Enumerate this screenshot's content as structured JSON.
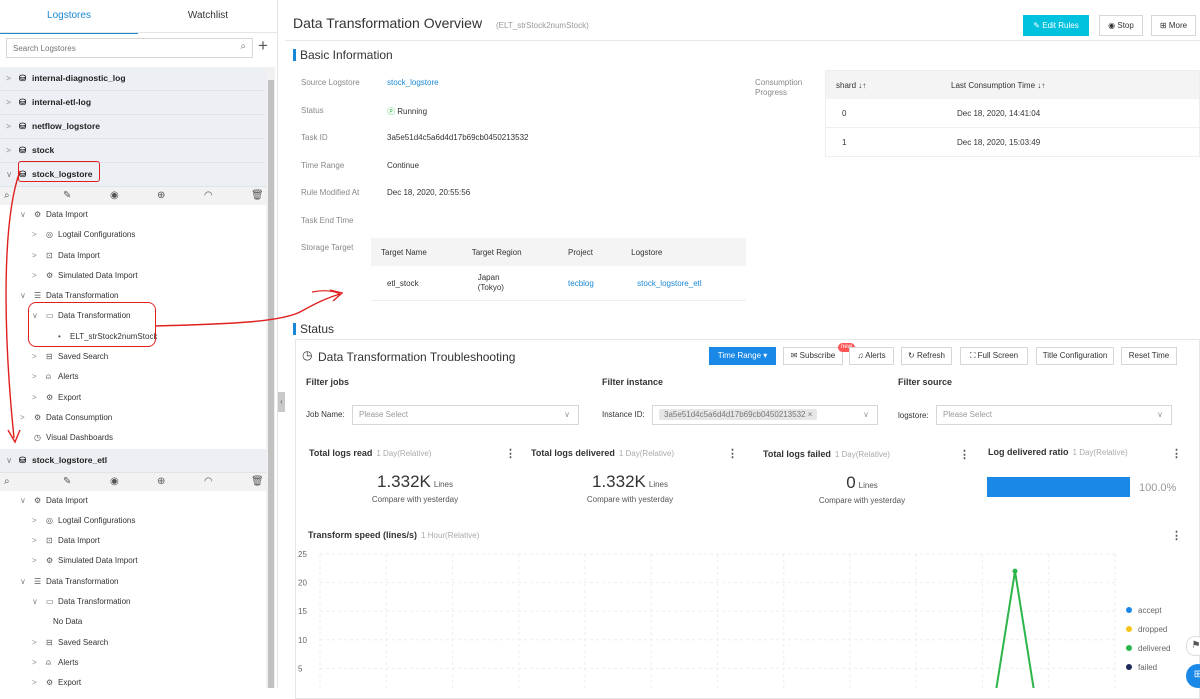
{
  "sidebar": {
    "tabs": [
      "Logstores",
      "Watchlist"
    ],
    "search_placeholder": "Search Logstores",
    "logstores": [
      "internal-diagnostic_log",
      "internal-etl-log",
      "netflow_logstore",
      "stock",
      "stock_logstore"
    ],
    "tree1": [
      {
        "label": "Data Import",
        "chev": "∨",
        "icon": "⚙"
      },
      {
        "label": "Logtail Configurations",
        "chev": ">",
        "icon": "◎"
      },
      {
        "label": "Data Import",
        "chev": ">",
        "icon": "⊡"
      },
      {
        "label": "Simulated Data Import",
        "chev": ">",
        "icon": "⚙"
      },
      {
        "label": "Data Transformation",
        "chev": "∨",
        "icon": "☰"
      },
      {
        "label": "Data Transformation",
        "chev": "∨",
        "icon": "▭"
      },
      {
        "label": "ELT_strStock2numStock",
        "chev": "",
        "icon": "•"
      },
      {
        "label": "Saved Search",
        "chev": ">",
        "icon": "⊟"
      },
      {
        "label": "Alerts",
        "chev": ">",
        "icon": "⍝"
      },
      {
        "label": "Export",
        "chev": ">",
        "icon": "⚙"
      },
      {
        "label": "Data Consumption",
        "chev": ">",
        "icon": "⚙"
      },
      {
        "label": "Visual Dashboards",
        "chev": "",
        "icon": "◷"
      }
    ],
    "logstore_etl": "stock_logstore_etl",
    "tree2": [
      {
        "label": "Data Import",
        "chev": "∨",
        "icon": "⚙"
      },
      {
        "label": "Logtail Configurations",
        "chev": ">",
        "icon": "◎"
      },
      {
        "label": "Data Import",
        "chev": ">",
        "icon": "⊡"
      },
      {
        "label": "Simulated Data Import",
        "chev": ">",
        "icon": "⚙"
      },
      {
        "label": "Data Transformation",
        "chev": "∨",
        "icon": "☰"
      },
      {
        "label": "Data Transformation",
        "chev": "∨",
        "icon": "▭"
      },
      {
        "label": "No Data",
        "chev": "",
        "icon": ""
      },
      {
        "label": "Saved Search",
        "chev": ">",
        "icon": "⊟"
      },
      {
        "label": "Alerts",
        "chev": ">",
        "icon": "⍝"
      },
      {
        "label": "Export",
        "chev": ">",
        "icon": "⚙"
      }
    ]
  },
  "header": {
    "title": "Data Transformation Overview",
    "subtitle": "(ELT_strStock2numStock)",
    "edit_rules": "Edit Rules",
    "stop": "Stop",
    "more": "More"
  },
  "basic": {
    "title": "Basic Information",
    "source_label": "Source Logstore",
    "source_value": "stock_logstore",
    "status_label": "Status",
    "status_value": "Running",
    "task_id_label": "Task ID",
    "task_id_value": "3a5e51d4c5a6d4d17b69cb0450213532",
    "time_range_label": "Time Range",
    "time_range_value": "Continue",
    "rule_modified_label": "Rule Modified At",
    "rule_modified_value": "Dec 18, 2020, 20:55:56",
    "task_end_label": "Task End Time",
    "storage_label": "Storage Target",
    "storage_headers": [
      "Target Name",
      "Target Region",
      "Project",
      "Logstore"
    ],
    "storage_row": {
      "name": "etl_stock",
      "region1": "Japan",
      "region2": "(Tokyo)",
      "project": "tecblog",
      "logstore": "stock_logstore_etl"
    },
    "consumption_label1": "Consumption",
    "consumption_label2": "Progress",
    "consumption_headers": [
      "shard ↓↑",
      "Last Consumption Time ↓↑"
    ],
    "consumption_rows": [
      [
        "0",
        "Dec 18, 2020, 14:41:04"
      ],
      [
        "1",
        "Dec 18, 2020, 15:03:49"
      ]
    ]
  },
  "status": {
    "title": "Status",
    "panel_title": "Data Transformation Troubleshooting",
    "time_range": "Time Range",
    "subscribe": "Subscribe",
    "new_badge": "new",
    "alerts": "Alerts",
    "refresh": "Refresh",
    "full_screen": "Full Screen",
    "title_config": "Title Configuration",
    "reset_time": "Reset Time",
    "filter_jobs": "Filter jobs",
    "filter_instance": "Filter instance",
    "filter_source": "Filter source",
    "job_name_label": "Job Name:",
    "job_name_placeholder": "Please Select",
    "instance_label": "Instance ID:",
    "instance_value": "3a5e51d4c5a6d4d17b69cb0450213532",
    "logstore_label": "logstore:",
    "logstore_placeholder": "Please Select"
  },
  "kpis": [
    {
      "title": "Total logs read",
      "sub": "1 Day(Relative)",
      "value": "1.332K",
      "unit": "Lines",
      "compare": "Compare with yesterday"
    },
    {
      "title": "Total logs delivered",
      "sub": "1 Day(Relative)",
      "value": "1.332K",
      "unit": "Lines",
      "compare": "Compare with yesterday"
    },
    {
      "title": "Total logs failed",
      "sub": "1 Day(Relative)",
      "value": "0",
      "unit": "Lines",
      "compare": "Compare with yesterday"
    },
    {
      "title": "Log delivered ratio",
      "sub": "1 Day(Relative)",
      "value": "100.0%"
    }
  ],
  "ratio": 1.0,
  "colors": {
    "accent": "#00c1de",
    "link": "#1a88d6",
    "running": "#2cb54a",
    "annotation": "#e0201f",
    "bar": "#1a88e6"
  },
  "chart_data": {
    "type": "line",
    "title": "Transform speed (lines/s)",
    "subtitle": "1 Hour(Relative)",
    "y_ticks": [
      5,
      10,
      15,
      20,
      25
    ],
    "ylim": [
      0,
      25
    ],
    "grid": true,
    "legend_position": "right",
    "series": [
      {
        "name": "accept",
        "color": "#1a88e6",
        "values": []
      },
      {
        "name": "dropped",
        "color": "#f5c518",
        "values": []
      },
      {
        "name": "delivered",
        "color": "#2cb54a",
        "values": [
          0,
          22,
          0
        ]
      },
      {
        "name": "failed",
        "color": "#1c2a5a",
        "values": []
      }
    ]
  }
}
